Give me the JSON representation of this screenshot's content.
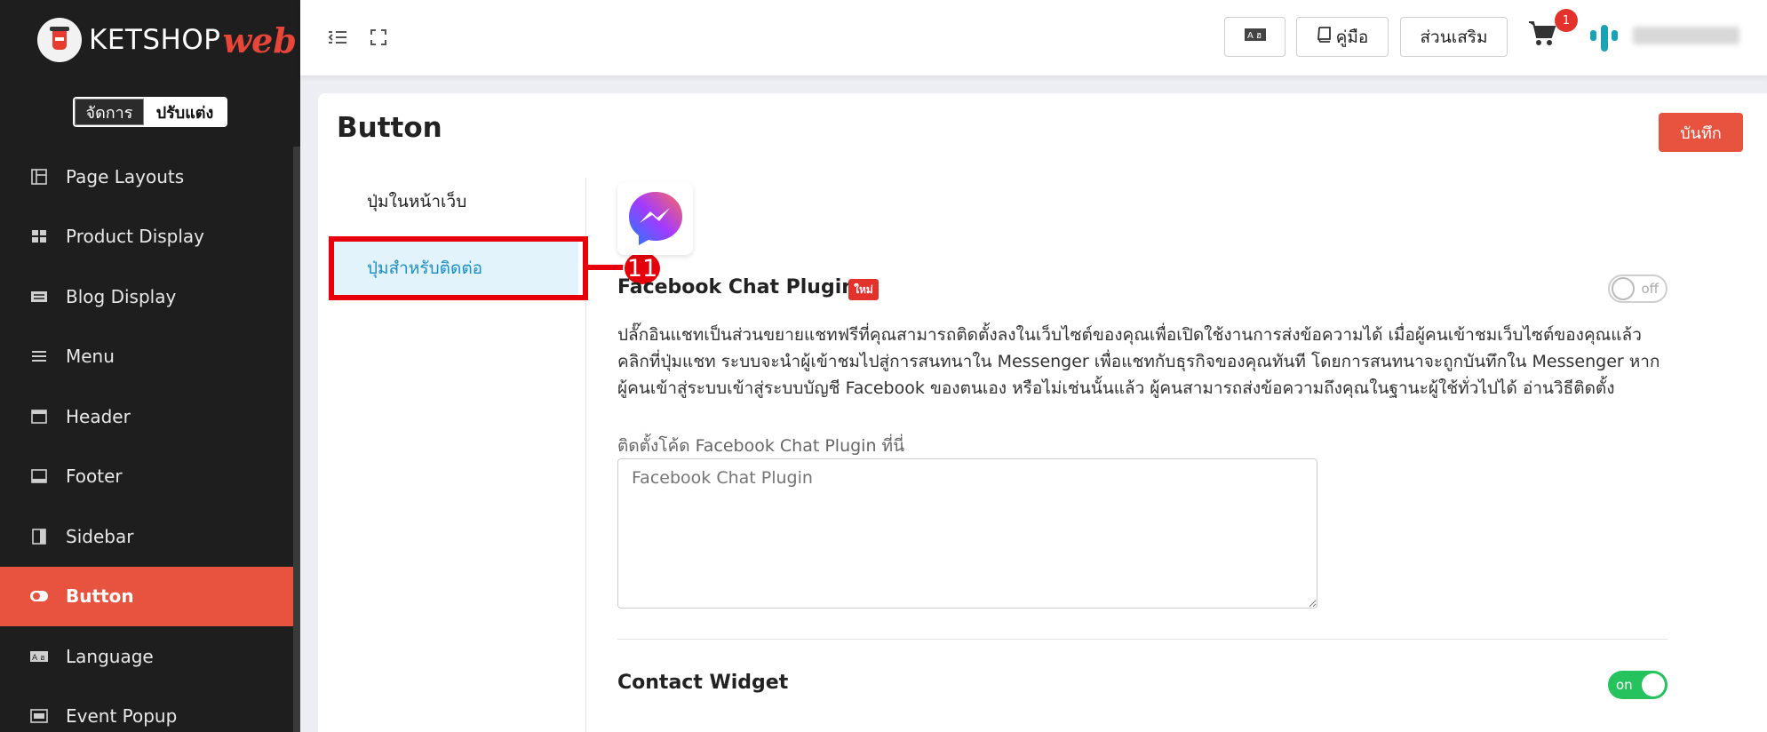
{
  "brand": {
    "name": "KETSHOP",
    "suffix": "web"
  },
  "mode": {
    "manage": "จัดการ",
    "customize": "ปรับแต่ง"
  },
  "sidebar": {
    "items": [
      {
        "label": "Page Layouts",
        "icon": "layout-icon"
      },
      {
        "label": "Product Display",
        "icon": "grid-icon"
      },
      {
        "label": "Blog Display",
        "icon": "newspaper-icon"
      },
      {
        "label": "Menu",
        "icon": "menu-icon"
      },
      {
        "label": "Header",
        "icon": "header-icon"
      },
      {
        "label": "Footer",
        "icon": "footer-icon"
      },
      {
        "label": "Sidebar",
        "icon": "sidebar-icon"
      },
      {
        "label": "Button",
        "icon": "toggle-icon",
        "active": true
      },
      {
        "label": "Language",
        "icon": "language-icon"
      },
      {
        "label": "Event Popup",
        "icon": "popup-icon"
      }
    ]
  },
  "topbar": {
    "manual_label": "คู่มือ",
    "addons_label": "ส่วนเสริม",
    "cart_count": "1"
  },
  "page": {
    "title": "Button",
    "save_label": "บันทึก",
    "subnav": [
      "ปุ่มในหน้าเว็บ",
      "ปุ่มสำหรับติดต่อ"
    ],
    "callout_number": "11",
    "fb": {
      "title": "Facebook Chat Plugin",
      "new_badge": "ใหม่",
      "toggle": "off",
      "description": "ปลั๊กอินแชทเป็นส่วนขยายแชทฟรีที่คุณสามารถติดตั้งลงในเว็บไซต์ของคุณเพื่อเปิดใช้งานการส่งข้อความได้ เมื่อผู้คนเข้าชมเว็บไซต์ของคุณแล้วคลิกที่ปุ่มแชท ระบบจะนำผู้เข้าชมไปสู่การสนทนาใน Messenger เพื่อแชทกับธุรกิจของคุณทันที โดยการสนทนาจะถูกบันทึกใน Messenger หากผู้คนเข้าสู่ระบบเข้าสู่ระบบบัญชี Facebook ของตนเอง หรือไม่เช่นนั้นแล้ว ผู้คนสามารถส่งข้อความถึงคุณในฐานะผู้ใช้ทั่วไปได้ อ่านวิธีติดตั้ง",
      "field_label": "ติดตั้งโค้ด Facebook Chat Plugin ที่นี่",
      "placeholder": "Facebook Chat Plugin"
    },
    "contact": {
      "title": "Contact Widget",
      "toggle": "on"
    }
  },
  "colors": {
    "accent": "#e7533f",
    "sidebar_bg": "#1e1e1e",
    "toggle_on": "#25c25e",
    "highlight": "#e5000b"
  }
}
